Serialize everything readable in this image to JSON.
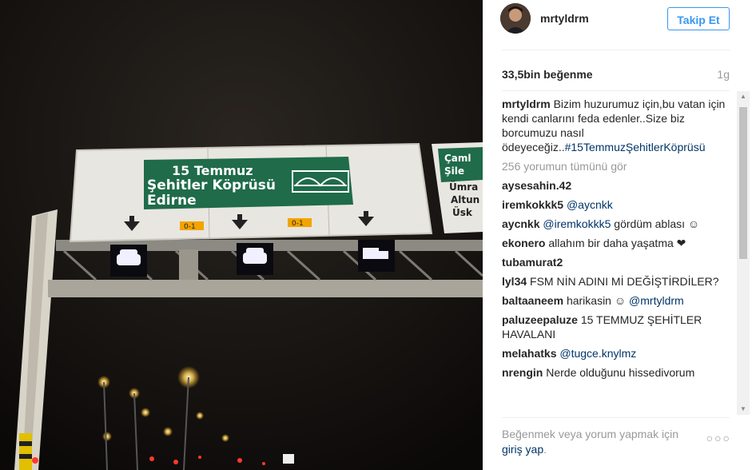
{
  "photo": {
    "sign": {
      "line1": "15 Temmuz",
      "line2": "Şehitler Köprüsü",
      "line3": "Edirne",
      "lane_label_1": "0-1",
      "lane_label_2": "0-1",
      "side_sign": "Çaml Şile Ümra Altun Üsk"
    }
  },
  "header": {
    "username": "mrtyldrm",
    "follow_label": "Takip Et"
  },
  "stats": {
    "likes": "33,5bin beğenme",
    "time": "1g"
  },
  "caption": {
    "username": "mrtyldrm",
    "text": "Bizim huzurumuz için,bu vatan için kendi canlarını feda edenler..Size biz borcumuzu nasıl ödeyeceğiz..",
    "hashtag": "#15TemmuzŞehitlerKöprüsü"
  },
  "view_all": "256 yorumun tümünü gör",
  "comments": [
    {
      "user": "aysesahin.42",
      "text": "",
      "mention": "",
      "after": ""
    },
    {
      "user": "iremkokkk5",
      "text": "",
      "mention": "@aycnkk",
      "after": ""
    },
    {
      "user": "aycnkk",
      "text": "",
      "mention": "@iremkokkk5",
      "after": " gördüm ablası ☺"
    },
    {
      "user": "ekonero",
      "text": "allahım bir daha yaşatma ❤",
      "mention": "",
      "after": ""
    },
    {
      "user": "tubamurat2",
      "text": "",
      "mention": "",
      "after": ""
    },
    {
      "user": "lyl34",
      "text": "FSM NİN ADINI Mİ DEĞİŞTİRDİLER?",
      "mention": "",
      "after": ""
    },
    {
      "user": "baltaaneem",
      "text": "harikasin ☺",
      "mention": "@mrtyldrm",
      "after": ""
    },
    {
      "user": "paluzeepaluze",
      "text": "15 TEMMUZ ŞEHİTLER HAVALANI",
      "mention": "",
      "after": ""
    },
    {
      "user": "melahatks",
      "text": "",
      "mention": "@tugce.knylmz",
      "after": ""
    },
    {
      "user": "nrengin",
      "text": "Nerde olduğunu hissedivorum",
      "mention": "",
      "after": ""
    }
  ],
  "footer": {
    "text": "Beğenmek veya yorum yapmak için",
    "login": "giriş yap",
    "period": ".",
    "more": "○○○"
  },
  "colors": {
    "accent": "#3897f0",
    "link": "#003569",
    "sign_green": "#1f6b4a"
  }
}
